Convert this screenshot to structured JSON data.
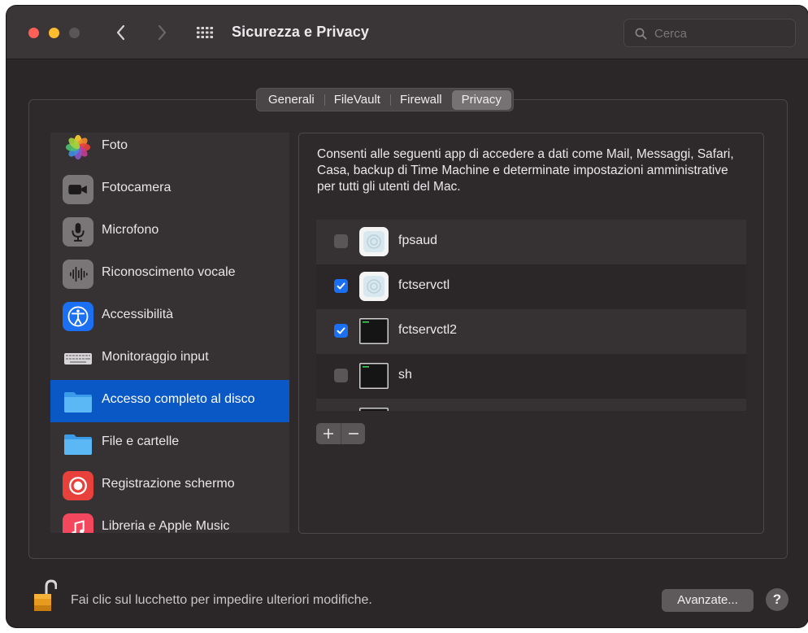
{
  "window": {
    "title": "Sicurezza e Privacy"
  },
  "search": {
    "placeholder": "Cerca"
  },
  "tabs": [
    {
      "label": "Generali",
      "selected": false
    },
    {
      "label": "FileVault",
      "selected": false
    },
    {
      "label": "Firewall",
      "selected": false
    },
    {
      "label": "Privacy",
      "selected": true
    }
  ],
  "sidebar": {
    "items": [
      {
        "label": "Foto",
        "icon": "photos-icon"
      },
      {
        "label": "Fotocamera",
        "icon": "camera-icon"
      },
      {
        "label": "Microfono",
        "icon": "microphone-icon"
      },
      {
        "label": "Riconoscimento vocale",
        "icon": "waveform-icon"
      },
      {
        "label": "Accessibilità",
        "icon": "accessibility-icon"
      },
      {
        "label": "Monitoraggio input",
        "icon": "keyboard-icon"
      },
      {
        "label": "Accesso completo al disco",
        "icon": "folder-icon",
        "selected": true
      },
      {
        "label": "File e cartelle",
        "icon": "folder-icon"
      },
      {
        "label": "Registrazione schermo",
        "icon": "screen-record-icon"
      },
      {
        "label": "Libreria e Apple Music",
        "icon": "music-icon"
      }
    ]
  },
  "panel": {
    "description": "Consenti alle seguenti app di accedere a dati come Mail, Messaggi, Safari, Casa, backup di Time Machine e determinate impostazioni amministrative per tutti gli utenti del Mac.",
    "apps": [
      {
        "name": "fpsaud",
        "checked": false,
        "icon": "generic-app-icon"
      },
      {
        "name": "fctservctl",
        "checked": true,
        "icon": "generic-app-icon"
      },
      {
        "name": "fctservctl2",
        "checked": true,
        "icon": "terminal-exec-icon"
      },
      {
        "name": "sh",
        "checked": false,
        "icon": "terminal-exec-icon"
      },
      {
        "name": "",
        "checked": false,
        "icon": "terminal-exec-icon"
      }
    ],
    "add_symbol": "+",
    "remove_symbol": "−"
  },
  "footer": {
    "lock_message": "Fai clic sul lucchetto per impedire ulteriori modifiche.",
    "advanced_label": "Avanzate...",
    "help_label": "?"
  },
  "colors": {
    "window_bg": "#2b2729",
    "selection": "#0a58c5",
    "checkbox_checked": "#1b6ff2"
  }
}
